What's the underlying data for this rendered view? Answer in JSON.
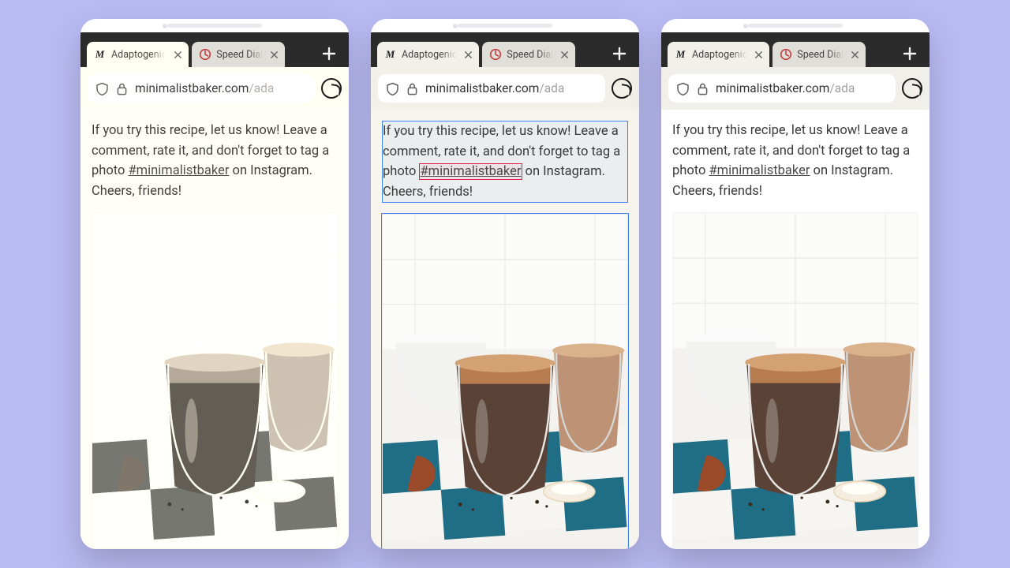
{
  "tabs": [
    {
      "label": "Adaptogenic",
      "favicon": "site"
    },
    {
      "label": "Speed Dial",
      "favicon": "dial"
    }
  ],
  "url": {
    "host": "minimalistbaker.com",
    "path": "/ada"
  },
  "page_text": {
    "before_link": "If you try this recipe, let us know! Leave a comment, rate it, and don't forget to tag a photo ",
    "link": "#minimalistbaker",
    "after_link": " on Instagram. Cheers, friends!"
  },
  "variants": [
    "sepia",
    "inspect",
    "normal"
  ]
}
